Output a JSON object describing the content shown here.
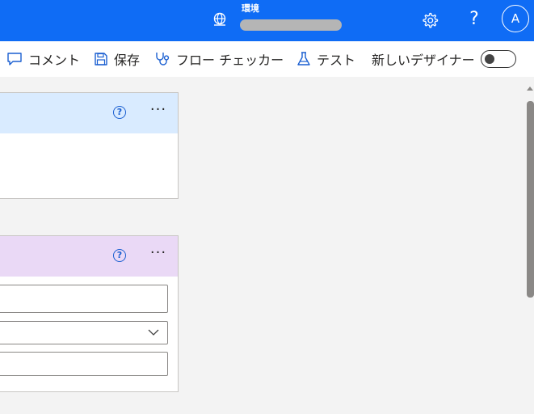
{
  "header": {
    "env_label": "環境",
    "avatar_initial": "A",
    "help_glyph": "?",
    "icons": [
      "globe-icon",
      "gear-icon",
      "help-icon"
    ],
    "background": "#0f6cf5"
  },
  "toolbar": {
    "comment_label": "コメント",
    "save_label": "保存",
    "flow_checker_label": "フロー チェッカー",
    "test_label": "テスト",
    "new_designer_label": "新しいデザイナー",
    "new_designer_toggle_on": false
  },
  "canvas": {
    "card_help_glyph": "?",
    "card_more_glyph": "···",
    "cards": [
      {
        "accent": "#d9ebff"
      },
      {
        "accent": "#ead9f6"
      }
    ]
  }
}
